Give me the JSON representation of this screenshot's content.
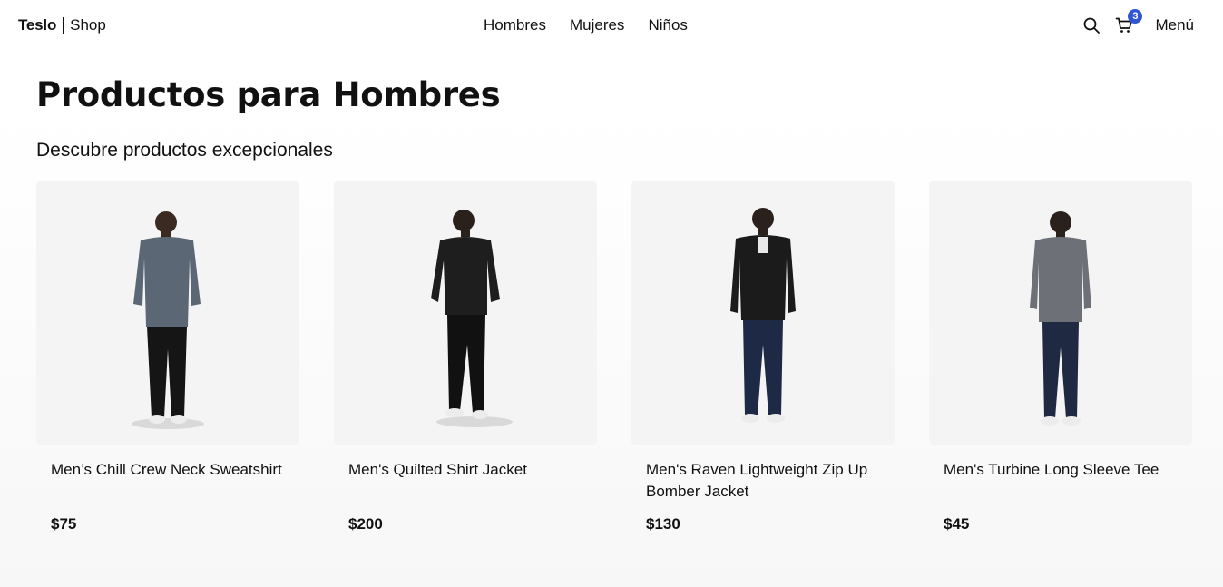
{
  "brand": {
    "name": "Teslo",
    "shop": "Shop"
  },
  "nav": {
    "links": [
      {
        "label": "Hombres"
      },
      {
        "label": "Mujeres"
      },
      {
        "label": "Niños"
      }
    ],
    "cart_count": "3",
    "menu_label": "Menú",
    "icons": {
      "search": "search-icon",
      "cart": "cart-icon"
    }
  },
  "page": {
    "title": "Productos para Hombres",
    "subtitle": "Descubre productos excepcionales"
  },
  "colors": {
    "badge": "#2f55d4",
    "card_bg": "#f4f4f4"
  },
  "products": [
    {
      "title": "Men’s Chill Crew Neck Sweatshirt",
      "price": "$75",
      "top_color": "#5b6774",
      "pants_color": "#151515"
    },
    {
      "title": "Men's Quilted Shirt Jacket",
      "price": "$200",
      "top_color": "#1e1e1f",
      "pants_color": "#111111"
    },
    {
      "title": "Men's Raven Lightweight Zip Up Bomber Jacket",
      "price": "$130",
      "top_color": "#1b1b1b",
      "pants_color": "#1e2a45"
    },
    {
      "title": "Men's Turbine Long Sleeve Tee",
      "price": "$45",
      "top_color": "#6d7077",
      "pants_color": "#1f2a42"
    }
  ]
}
